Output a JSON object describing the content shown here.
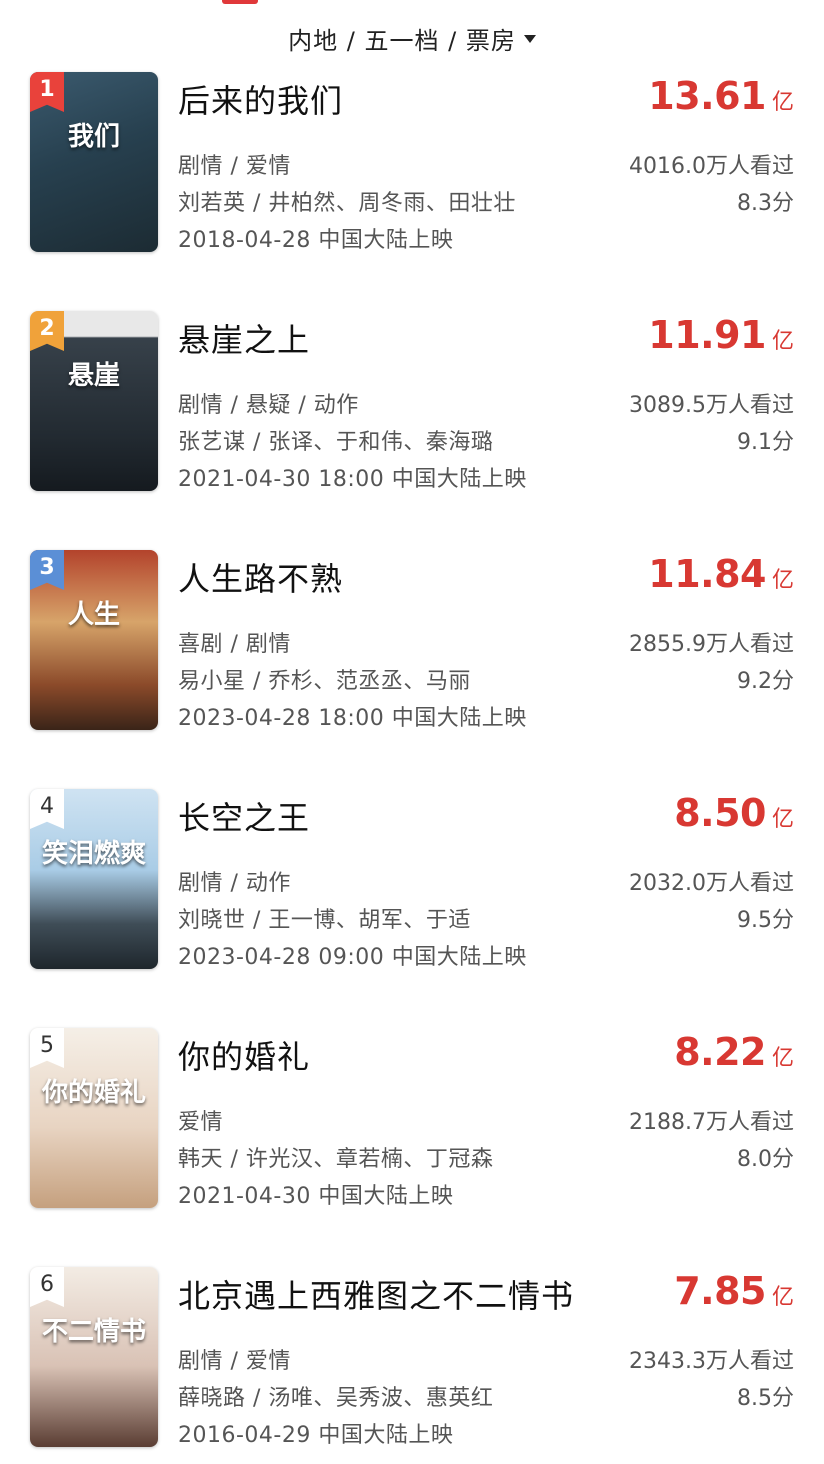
{
  "filter": {
    "label": "内地 / 五一档 / 票房"
  },
  "colors": {
    "accent": "#d83832",
    "rank1": "#e9423b",
    "rank2": "#f0a23a",
    "rank3": "#5b8fd6"
  },
  "movies": [
    {
      "rank": "1",
      "title": "后来的我们",
      "box_value": "13.61",
      "box_unit": "亿",
      "genre": "剧情 / 爱情",
      "people": "刘若英 / 井柏然、周冬雨、田壮壮",
      "release": "2018-04-28 中国大陆上映",
      "viewers": "4016.0万人看过",
      "score": "8.3分"
    },
    {
      "rank": "2",
      "title": "悬崖之上",
      "box_value": "11.91",
      "box_unit": "亿",
      "genre": "剧情 / 悬疑 / 动作",
      "people": "张艺谋 / 张译、于和伟、秦海璐",
      "release": "2021-04-30 18:00 中国大陆上映",
      "viewers": "3089.5万人看过",
      "score": "9.1分"
    },
    {
      "rank": "3",
      "title": "人生路不熟",
      "box_value": "11.84",
      "box_unit": "亿",
      "genre": "喜剧 / 剧情",
      "people": "易小星 / 乔杉、范丞丞、马丽",
      "release": "2023-04-28 18:00 中国大陆上映",
      "viewers": "2855.9万人看过",
      "score": "9.2分"
    },
    {
      "rank": "4",
      "title": "长空之王",
      "box_value": "8.50",
      "box_unit": "亿",
      "genre": "剧情 / 动作",
      "people": "刘晓世 / 王一博、胡军、于适",
      "release": "2023-04-28 09:00 中国大陆上映",
      "viewers": "2032.0万人看过",
      "score": "9.5分"
    },
    {
      "rank": "5",
      "title": "你的婚礼",
      "box_value": "8.22",
      "box_unit": "亿",
      "genre": "爱情",
      "people": "韩天 / 许光汉、章若楠、丁冠森",
      "release": "2021-04-30 中国大陆上映",
      "viewers": "2188.7万人看过",
      "score": "8.0分"
    },
    {
      "rank": "6",
      "title": "北京遇上西雅图之不二情书",
      "box_value": "7.85",
      "box_unit": "亿",
      "genre": "剧情 / 爱情",
      "people": "薛晓路 / 汤唯、吴秀波、惠英红",
      "release": "2016-04-29 中国大陆上映",
      "viewers": "2343.3万人看过",
      "score": "8.5分"
    }
  ],
  "posters": [
    {
      "text": "我们",
      "bg": "linear-gradient(160deg,#3b5a6e 0%,#27404f 45%,#1c2b33 100%)"
    },
    {
      "text": "悬崖",
      "bg": "linear-gradient(180deg,#e8e8e8 0%,#e8e8e8 14%,#37414a 15%,#222a31 70%,#151a1f 100%)"
    },
    {
      "text": "人生",
      "bg": "linear-gradient(180deg,#b3432c 0%,#d7a46a 40%,#8b4a2a 75%,#3a2418 100%)"
    },
    {
      "text": "笑泪燃爽",
      "bg": "linear-gradient(180deg,#cfe3f2 0%,#a9cce6 45%,#3f4d57 75%,#1e262c 100%)"
    },
    {
      "text": "你的婚礼",
      "bg": "linear-gradient(180deg,#f5efe7 0%,#e8d4c2 55%,#c5a07e 100%)"
    },
    {
      "text": "不二情书",
      "bg": "linear-gradient(180deg,#f3ece4 0%,#d9c2b5 55%,#5a3d33 100%)"
    }
  ]
}
